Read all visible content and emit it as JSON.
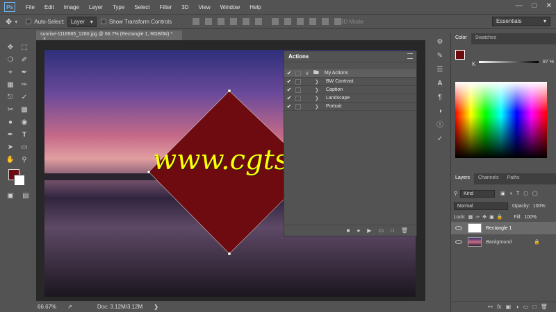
{
  "app": {
    "logo": "Ps"
  },
  "menu": [
    "File",
    "Edit",
    "Image",
    "Layer",
    "Type",
    "Select",
    "Filter",
    "3D",
    "View",
    "Window",
    "Help"
  ],
  "options": {
    "auto_select_label": "Auto-Select:",
    "auto_select_value": "Layer",
    "show_transform_label": "Show Transform Controls",
    "mode_3d_label": "3D Mode:",
    "workspace": "Essentials"
  },
  "document": {
    "tab_title": "sunrise-1116985_1280.jpg @ 66.7% (Rectangle 1, RGB/8#) *",
    "zoom": "66.67%",
    "doc_size": "Doc: 3.12M/3.12M",
    "watermark": "www.cgtsj.com"
  },
  "actions_panel": {
    "title": "Actions",
    "set_name": "My Actions",
    "items": [
      "BW Contrast",
      "Caption",
      "Landscape",
      "Portrait"
    ]
  },
  "color_panel": {
    "tabs": [
      "Color",
      "Swatches"
    ],
    "channel": "K",
    "value": "87",
    "unit": "%",
    "fg_color": "#6e0b10"
  },
  "layers_panel": {
    "tabs": [
      "Layers",
      "Channels",
      "Paths"
    ],
    "filter_label": "Kind",
    "blend_mode": "Normal",
    "opacity_label": "Opacity:",
    "opacity_value": "100%",
    "lock_label": "Lock:",
    "fill_label": "Fill:",
    "fill_value": "100%",
    "layers": [
      {
        "name": "Rectangle 1",
        "selected": true
      },
      {
        "name": "Background",
        "selected": false
      }
    ]
  },
  "colors": {
    "accent": "#6fb4f0",
    "rect": "#6e0b10",
    "watermark": "#ffff00"
  }
}
